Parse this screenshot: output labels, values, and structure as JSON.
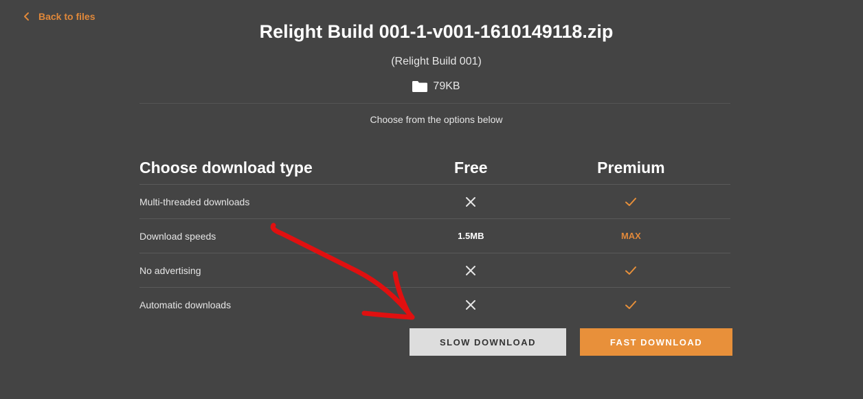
{
  "nav": {
    "back_label": "Back to files"
  },
  "file": {
    "title": "Relight Build 001-1-v001-1610149118.zip",
    "subtitle": "(Relight Build 001)",
    "size": "79KB"
  },
  "prompt": "Choose from the options below",
  "table": {
    "headers": {
      "feature": "Choose download type",
      "free": "Free",
      "premium": "Premium"
    },
    "rows": [
      {
        "feature": "Multi-threaded downloads",
        "free": "cross-icon",
        "premium": "check-icon"
      },
      {
        "feature": "Download speeds",
        "free": "1.5MB",
        "premium": "MAX"
      },
      {
        "feature": "No advertising",
        "free": "cross-icon",
        "premium": "check-icon"
      },
      {
        "feature": "Automatic downloads",
        "free": "cross-icon",
        "premium": "check-icon"
      }
    ]
  },
  "buttons": {
    "slow": "SLOW DOWNLOAD",
    "fast": "FAST DOWNLOAD"
  },
  "colors": {
    "background": "#444444",
    "accent": "#e8903a",
    "slow_button": "#dddddd",
    "annotation_arrow": "#e01010"
  }
}
